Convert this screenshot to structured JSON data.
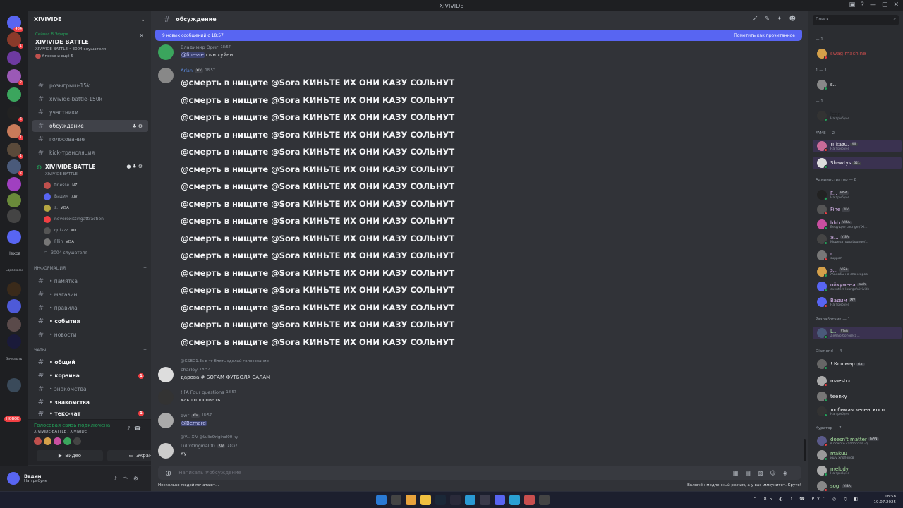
{
  "window": {
    "title": "XIVIVIDE"
  },
  "servers": [
    {
      "color": "#5865f2",
      "badge": "484"
    },
    {
      "color": "#8a3a2a",
      "badge": "1"
    },
    {
      "color": "#6d3aa0",
      "badge": ""
    },
    {
      "color": "#9b59b6",
      "badge": "2"
    },
    {
      "color": "#3ba55d",
      "badge": ""
    },
    {
      "color": "#222222",
      "badge": "6"
    },
    {
      "color": "#c97b5a",
      "badge": "1"
    },
    {
      "color": "#5a4a3a",
      "badge": "1"
    },
    {
      "color": "#4a5a7a",
      "badge": "2"
    },
    {
      "color": "#a040c0",
      "badge": ""
    },
    {
      "color": "#6a8a3a",
      "badge": ""
    },
    {
      "color": "#444444",
      "badge": ""
    },
    {
      "color": "#5865f2",
      "badge": ""
    }
  ],
  "servers2": [
    {
      "color": "#3a2a1a"
    },
    {
      "color": "#4e5ad8"
    },
    {
      "color": "#5a4a4a"
    },
    {
      "color": "#1a1a3a"
    },
    {
      "color": "#3a4a5a"
    }
  ],
  "server_labels": {
    "chekhov": "Чехов",
    "label2": "Ьдмпскаем",
    "label3": "Зачмавать"
  },
  "new_label": "НОВОЕ",
  "guild": {
    "name": "XIVIVIDE"
  },
  "event": {
    "live": "Сейчас В Эфире",
    "name": "XIVIVIDE BATTLE",
    "sub": "XIVIVIDE-BATTLE • 3004 слушателя",
    "who": "finesse и ещё 5"
  },
  "channels_top": [
    {
      "name": "розыгрыш-15k"
    },
    {
      "name": "xivivide-battle-150k"
    },
    {
      "name": "участники"
    },
    {
      "name": "обсуждение"
    },
    {
      "name": "голосование"
    },
    {
      "name": "kick-трансляция"
    }
  ],
  "voice": {
    "name": "XIVIVIDE-BATTLE",
    "sub": "XIVIVIDE BATTLE",
    "users": [
      {
        "name": "finesse",
        "tag": "NZ",
        "color": "#c0504d"
      },
      {
        "name": "Вадим",
        "tag": "XIV",
        "color": "#5865f2"
      },
      {
        "name": "s.",
        "tag": "VISA",
        "color": "#b5a642"
      },
      {
        "name": "neverexistingattraction",
        "tag": "",
        "color": "#f23f43"
      },
      {
        "name": "qutzzz",
        "tag": "XIII",
        "color": "#555555"
      },
      {
        "name": "Fllin",
        "tag": "VISA",
        "color": "#777777"
      }
    ],
    "count": "3004 слушателя"
  },
  "category_info": "ИНФОРМАЦИЯ",
  "channels_info": [
    {
      "name": "• памятка"
    },
    {
      "name": "• магазин"
    },
    {
      "name": "• правила"
    },
    {
      "name": "• события"
    },
    {
      "name": "• новости"
    }
  ],
  "category_chats": "ЧАТЫ",
  "channels_chats": [
    {
      "name": "• общий",
      "badge": ""
    },
    {
      "name": "• корзина",
      "badge": "1"
    },
    {
      "name": "• знакомства",
      "badge": ""
    },
    {
      "name": "• знакомства",
      "badge": ""
    },
    {
      "name": "• текс-чат",
      "badge": "1"
    }
  ],
  "voicebar": {
    "status": "Голосовая связь подключена",
    "sub": "XIVIVIDE-BATTLE / XIVIVIDE",
    "video": "Видео",
    "screen": "Экран"
  },
  "user": {
    "name": "Вадим",
    "status": "На трибуне"
  },
  "channel": {
    "name": "обсуждение"
  },
  "newbar": {
    "left": "9 новых сообщений с 18:57",
    "right": "Пометить как прочитанное"
  },
  "messages": {
    "m1": {
      "author": "Владимир Ориг",
      "tag": "",
      "time": "18:57",
      "mention": "@finesse",
      "text": " сын хуйни"
    },
    "m2": {
      "author": "Arlan",
      "tag": "XIV",
      "time": "18:57"
    },
    "spam_text": "@смерть в нищите @Sora КИНЬТЕ ИХ ОНИ КАЗУ СОЛЬНУТ",
    "m3": {
      "reply": "@GSBO1.3s в тг блять сделай голосование",
      "author": "charley",
      "time": "18:57",
      "text": "дарова # БОГАМ ФУТБОЛА САЛАМ"
    },
    "m4": {
      "author": "! [A Four questions",
      "time": "18:57",
      "text": "как голосовать"
    },
    "m5": {
      "author": "qwr",
      "tag": "XIV",
      "time": "18:57",
      "mention": "@Bernard"
    },
    "m6": {
      "reply": "@V...  XIV  @LulixOriginal00 ку",
      "author": "LulixOriginal00",
      "tag": "XIV",
      "time": "18:57",
      "text": "ку"
    }
  },
  "composer": {
    "placeholder": "Написать #обсуждение"
  },
  "typing": "Несколько людей печатают...",
  "slowmode": "Включён медленный режим, а у вас иммунитет. Круто!",
  "members": {
    "search": "Поиск",
    "cats": {
      "c1": "— 1",
      "c2": "1 — 1",
      "c3": "— 1",
      "c4": "FAME — 2",
      "c5": "Администратор — 8",
      "c6": "Разработчик — 1",
      "c7": "Diamond — 4",
      "c8": "Куратор — 7"
    },
    "list": [
      {
        "name": "swag machine",
        "sub": "",
        "tag": "",
        "color": "#c14b4b",
        "av": "#d4a04a"
      },
      {
        "name": "s..",
        "sub": "",
        "tag": "",
        "color": "#f2f3f5",
        "av": "#888888"
      },
      {
        "name": "leon",
        "sub": "На трибуне",
        "tag": "",
        "color": "#1e1f22",
        "av": "#333333"
      },
      {
        "name": "!! kazu.",
        "sub": "На трибуне",
        "tag": "XIII",
        "color": "#f2f3f5",
        "av": "#c96a9a"
      },
      {
        "name": "Shawtys",
        "sub": "",
        "tag": "321",
        "color": "#f2f3f5",
        "av": "#dddddd"
      },
      {
        "name": "F...",
        "sub": "На трибуне",
        "tag": "VISA",
        "color": "#dbb8f0",
        "av": "#222222"
      },
      {
        "name": "Fine",
        "sub": "",
        "tag": "XIV",
        "color": "#dbb8f0",
        "av": "#555555"
      },
      {
        "name": "hhh",
        "sub": "Ведущие Lounge / Xi...",
        "tag": "VISA",
        "color": "#dbb8f0",
        "av": "#c94fa0"
      },
      {
        "name": "Я...",
        "sub": "Модераторы Lounge/...",
        "tag": "VISA",
        "color": "#dbb8f0",
        "av": "#444444"
      },
      {
        "name": "r...",
        "sub": "support",
        "tag": "",
        "color": "#dbb8f0",
        "av": "#777777"
      },
      {
        "name": "s...",
        "sub": "Жалобы на спонсоров",
        "tag": "VISA",
        "color": "#dbb8f0",
        "av": "#d4a04a"
      },
      {
        "name": "ойкумена",
        "sub": "eventers lounge/xivivide",
        "tag": "cash",
        "color": "#dbb8f0",
        "av": "#5865f2"
      },
      {
        "name": "Вадим",
        "sub": "На трибуне",
        "tag": "XIV",
        "color": "#dbb8f0",
        "av": "#5865f2"
      },
      {
        "name": "L...",
        "sub": "Делаю ботов/са...",
        "tag": "VISA",
        "color": "#a8e0a0",
        "av": "#4a5a7a"
      },
      {
        "name": "! Кошмар",
        "sub": "",
        "tag": "star",
        "color": "#f2f3f5",
        "av": "#666666"
      },
      {
        "name": "maestrx",
        "sub": "",
        "tag": "",
        "color": "#f2f3f5",
        "av": "#aaaaaa"
      },
      {
        "name": "teenky",
        "sub": "",
        "tag": "",
        "color": "#f2f3f5",
        "av": "#777777"
      },
      {
        "name": "любимая зеленского",
        "sub": "На трибуне",
        "tag": "",
        "color": "#f2f3f5",
        "av": "#333333"
      },
      {
        "name": "doesn't matter",
        "sub": "в поиске саппортов -д...",
        "tag": "ISAN",
        "color": "#a8e0a0",
        "av": "#5a5a8a"
      },
      {
        "name": "makuu",
        "sub": "ищу хлопоров",
        "tag": "",
        "color": "#a8e0a0",
        "av": "#999999"
      },
      {
        "name": "melody",
        "sub": "На трибуне",
        "tag": "",
        "color": "#a8e0a0",
        "av": "#aaaaaa"
      },
      {
        "name": "sogi",
        "sub": "",
        "tag": "VISA",
        "color": "#a8e0a0",
        "av": "#888888"
      }
    ]
  },
  "taskbar": {
    "lang": "РУС",
    "vol": "85",
    "time": "18:58",
    "date": "19.07.2025"
  }
}
